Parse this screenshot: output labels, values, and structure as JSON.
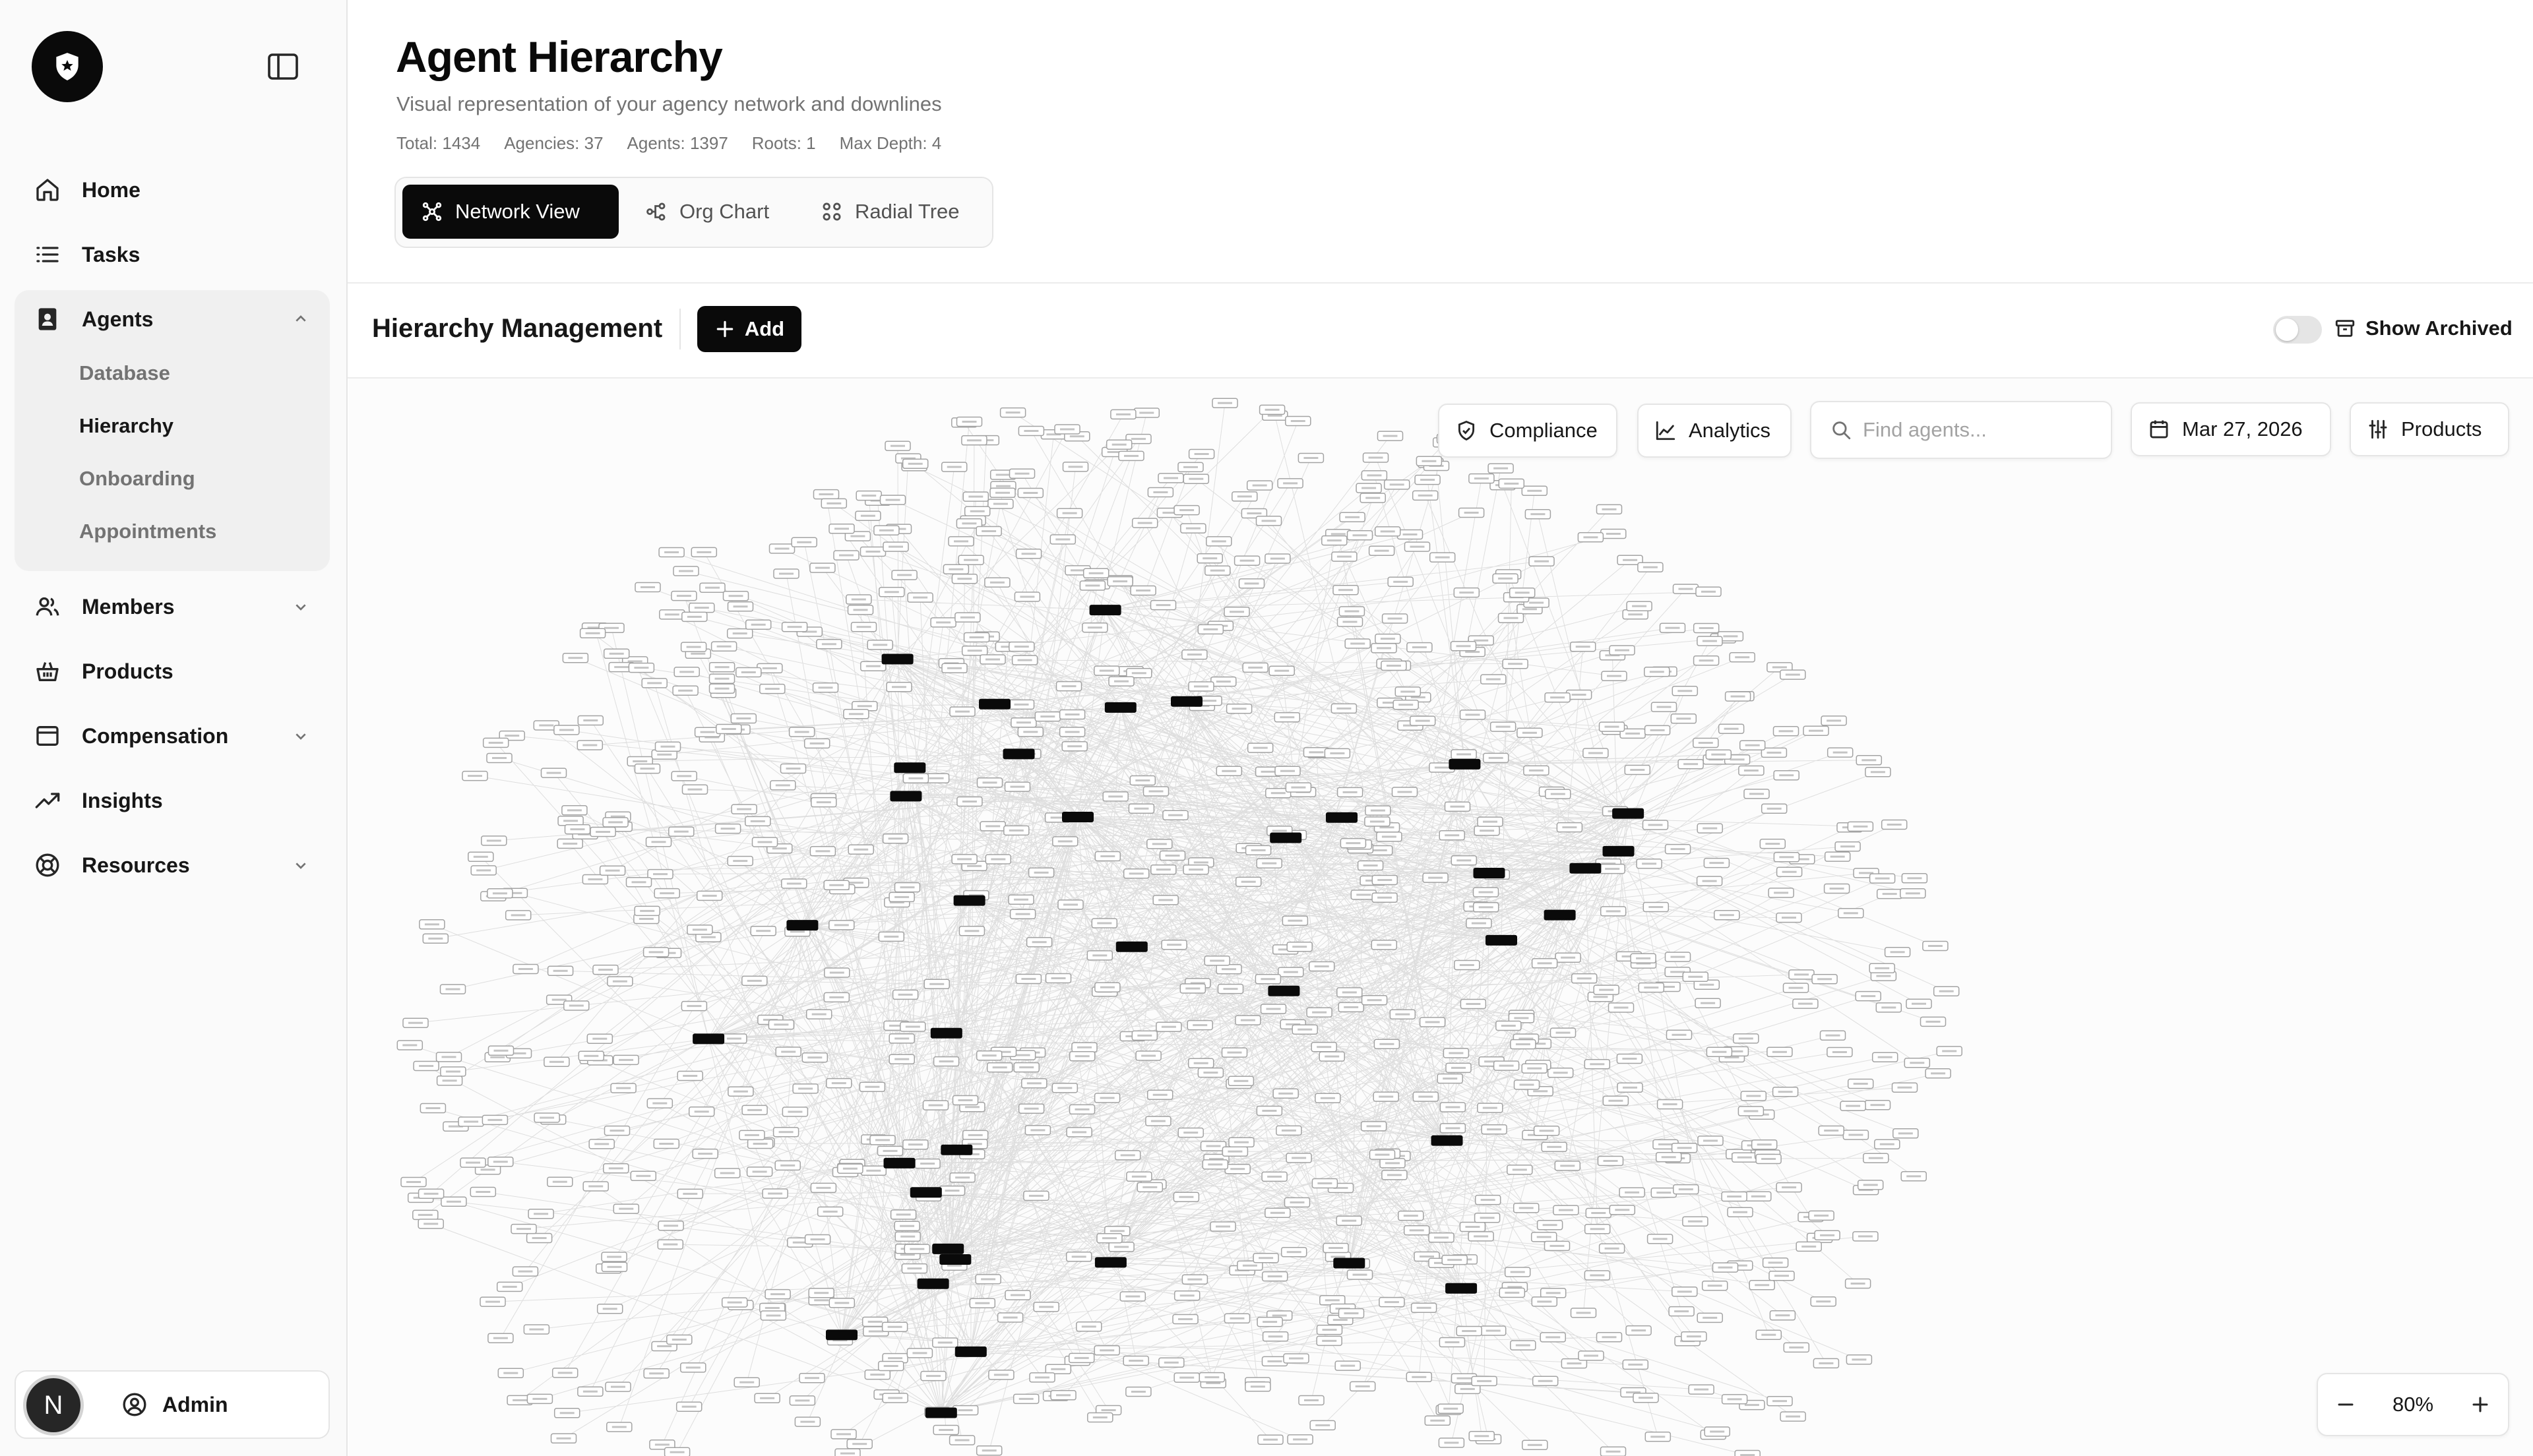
{
  "sidebar": {
    "logo_icon": "shield-star-icon",
    "collapse_icon": "sidebar-panel-icon",
    "nav": [
      {
        "label": "Home",
        "icon": "home-icon"
      },
      {
        "label": "Tasks",
        "icon": "list-icon"
      },
      {
        "label": "Agents",
        "icon": "id-badge-icon",
        "expanded": true
      },
      {
        "label": "Members",
        "icon": "users-icon"
      },
      {
        "label": "Products",
        "icon": "basket-icon"
      },
      {
        "label": "Compensation",
        "icon": "wallet-icon"
      },
      {
        "label": "Insights",
        "icon": "trend-up-icon"
      },
      {
        "label": "Resources",
        "icon": "lifebuoy-icon"
      }
    ],
    "agents_sub": [
      {
        "label": "Database",
        "active": false
      },
      {
        "label": "Hierarchy",
        "active": true
      },
      {
        "label": "Onboarding",
        "active": false
      },
      {
        "label": "Appointments",
        "active": false
      }
    ],
    "user": {
      "avatar_letter": "N",
      "role": "Admin"
    }
  },
  "header": {
    "title": "Agent Hierarchy",
    "subtitle": "Visual representation of your agency network and downlines",
    "stats": [
      "Total: 1434",
      "Agencies: 37",
      "Agents: 1397",
      "Roots: 1",
      "Max Depth: 4"
    ],
    "tabs": [
      {
        "label": "Network View",
        "icon": "network-icon",
        "active": true
      },
      {
        "label": "Org Chart",
        "icon": "org-chart-icon",
        "active": false
      },
      {
        "label": "Radial Tree",
        "icon": "radial-tree-icon",
        "active": false
      }
    ]
  },
  "toolbar": {
    "section_title": "Hierarchy Management",
    "add_label": "Add",
    "show_archived_label": "Show Archived",
    "show_archived_on": false
  },
  "canvas": {
    "compliance_label": "Compliance",
    "analytics_label": "Analytics",
    "search_placeholder": "Find agents...",
    "search_value": "",
    "date_label": "Mar 27, 2026",
    "products_label": "Products",
    "zoom_label": "80%"
  },
  "colors": {
    "accent": "#0a0a0a",
    "node_border": "#a3a3a3",
    "edge": "#d4d4d4",
    "muted_text": "#737373"
  }
}
